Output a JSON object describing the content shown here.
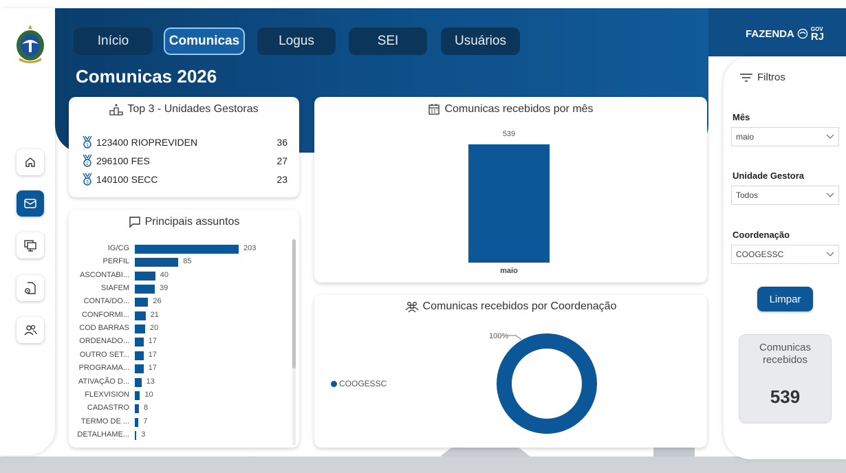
{
  "nav": {
    "items": [
      "Início",
      "Comunicas",
      "Logus",
      "SEI",
      "Usuários"
    ],
    "active": "Comunicas"
  },
  "page_title": "Comunicas 2026",
  "brand": {
    "fazenda": "FAZENDA",
    "gov": "GOV",
    "rj": "RJ"
  },
  "colors": {
    "header": "#0e4d86",
    "accent": "#0c5797",
    "nav_button": "#0b3559"
  },
  "sidebar": {
    "icons": [
      "home-icon",
      "mail-icon",
      "monitor-icon",
      "document-settings-icon",
      "users-icon"
    ],
    "active": "mail-icon"
  },
  "top3": {
    "title": "Top 3 - Unidades Gestoras",
    "rows": [
      {
        "rank": "1",
        "name": "123400 RIOPREVIDEN",
        "value": "36"
      },
      {
        "rank": "2",
        "name": "296100 FES",
        "value": "27"
      },
      {
        "rank": "3",
        "name": "140100 SECC",
        "value": "23"
      }
    ]
  },
  "assuntos": {
    "title": "Principais assuntos",
    "items": [
      {
        "label": "IG/CG",
        "value": 203
      },
      {
        "label": "PERFIL",
        "value": 85
      },
      {
        "label": "ASCONTABI...",
        "value": 40
      },
      {
        "label": "SIAFEM",
        "value": 39
      },
      {
        "label": "CONTA/DO...",
        "value": 26
      },
      {
        "label": "CONFORMI...",
        "value": 21
      },
      {
        "label": "COD BARRAS",
        "value": 20
      },
      {
        "label": "ORDENADO...",
        "value": 17
      },
      {
        "label": "OUTRO SET...",
        "value": 17
      },
      {
        "label": "PROGRAMA...",
        "value": 17
      },
      {
        "label": "ATIVAÇÃO D...",
        "value": 13
      },
      {
        "label": "FLEXVISION",
        "value": 10
      },
      {
        "label": "CADASTRO",
        "value": 8
      },
      {
        "label": "TERMO DE ...",
        "value": 7
      },
      {
        "label": "DETALHAME...",
        "value": 3
      }
    ]
  },
  "por_mes": {
    "title": "Comunicas recebidos por mês",
    "category": "maio",
    "value": "539"
  },
  "por_coord": {
    "title": "Comunicas recebidos por Coordenação",
    "legend": "COOGESSC",
    "percent_label": "100%"
  },
  "filters": {
    "title": "Filtros",
    "mes_label": "Mês",
    "mes_value": "maio",
    "ug_label": "Unidade Gestora",
    "ug_value": "Todos",
    "coord_label": "Coordenação",
    "coord_value": "COOGESSC",
    "clear_button": "Limpar"
  },
  "kpi": {
    "label": "Comunicas recebidos",
    "value": "539"
  },
  "chart_data": [
    {
      "type": "bar",
      "title": "Principais assuntos",
      "orientation": "horizontal",
      "categories": [
        "IG/CG",
        "PERFIL",
        "ASCONTABI...",
        "SIAFEM",
        "CONTA/DO...",
        "CONFORMI...",
        "COD BARRAS",
        "ORDENADO...",
        "OUTRO SET...",
        "PROGRAMA...",
        "ATIVAÇÃO D...",
        "FLEXVISION",
        "CADASTRO",
        "TERMO DE ...",
        "DETALHAME..."
      ],
      "values": [
        203,
        85,
        40,
        39,
        26,
        21,
        20,
        17,
        17,
        17,
        13,
        10,
        8,
        7,
        3
      ]
    },
    {
      "type": "bar",
      "title": "Comunicas recebidos por mês",
      "categories": [
        "maio"
      ],
      "values": [
        539
      ]
    },
    {
      "type": "pie",
      "title": "Comunicas recebidos por Coordenação",
      "categories": [
        "COOGESSC"
      ],
      "values": [
        100
      ],
      "donut": true
    }
  ]
}
